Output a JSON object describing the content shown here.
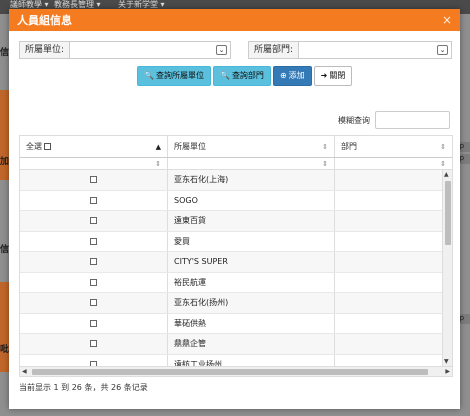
{
  "background": {
    "menu": [
      "議師教學 ▾",
      "教務長管理 ▾",
      "关于新学堂 ▾"
    ],
    "side_labels": [
      "信",
      "加",
      "信",
      "吡"
    ],
    "right_tags": [
      "sp",
      "sp",
      "sp"
    ]
  },
  "modal": {
    "title": "人員組信息",
    "close_icon": "×",
    "unit_label": "所屬單位:",
    "dept_label": "所屬部門:",
    "buttons": {
      "query_unit": "查詢所屬單位",
      "query_dept": "查詢部門",
      "add": "添加",
      "close": "關閉"
    },
    "search_label": "模糊查询",
    "search_value": "",
    "table": {
      "headers": {
        "select_all": "全選",
        "unit": "所屬單位",
        "dept": "部門"
      },
      "rows": [
        {
          "unit": "亚东石化(上海)",
          "dept": ""
        },
        {
          "unit": "SOGO",
          "dept": ""
        },
        {
          "unit": "遠東百貨",
          "dept": ""
        },
        {
          "unit": "愛買",
          "dept": ""
        },
        {
          "unit": "CITY'S SUPER",
          "dept": ""
        },
        {
          "unit": "裕民航運",
          "dept": ""
        },
        {
          "unit": "亚东石化(扬州)",
          "dept": ""
        },
        {
          "unit": "華砳供熱",
          "dept": ""
        },
        {
          "unit": "鼎鼎企管",
          "dept": ""
        },
        {
          "unit": "遠紡工业扬州",
          "dept": ""
        }
      ]
    },
    "footer": "当前显示 1 到 26 条，共 26 条记录"
  }
}
